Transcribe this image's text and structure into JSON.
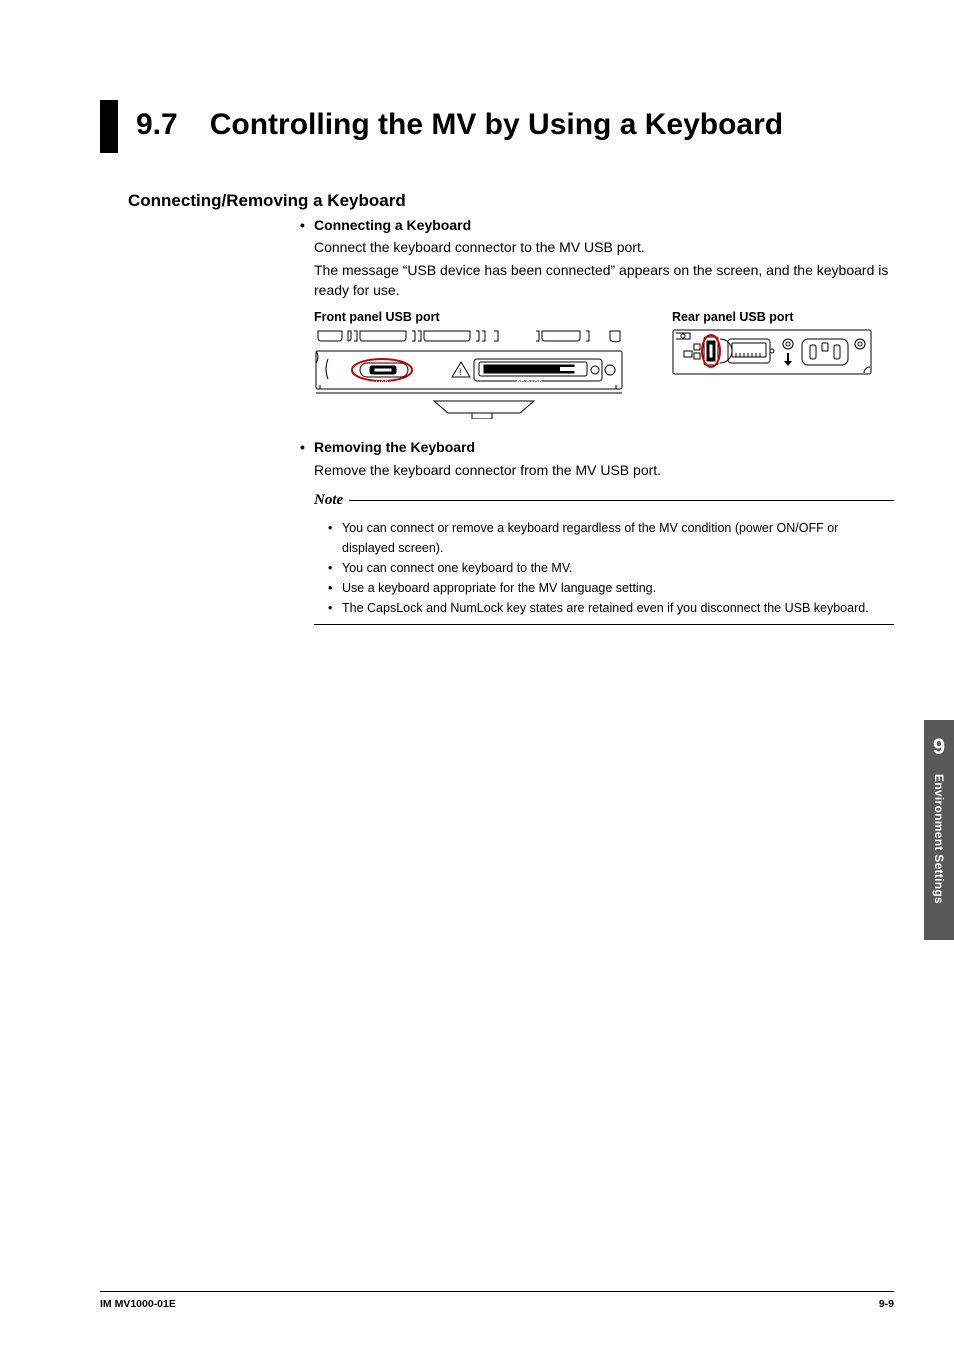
{
  "heading": {
    "number": "9.7",
    "title": "Controlling the MV by Using a Keyboard"
  },
  "section1": {
    "title": "Connecting/Removing a Keyboard",
    "connect": {
      "head": "Connecting a Keyboard",
      "p1": "Connect the keyboard connector to the MV USB port.",
      "p2": "The message “USB device has been connected” appears on the screen, and the keyboard is ready for use.",
      "figFrontLabel": "Front panel USB port",
      "figRearLabel": "Rear panel USB port",
      "figFrontTextUSB": "USB",
      "figFrontTextCF": "CF CARD"
    },
    "remove": {
      "head": "Removing the Keyboard",
      "p1": "Remove the keyboard connector from the MV USB port."
    },
    "note": {
      "word": "Note",
      "items": [
        "You can connect or remove a keyboard regardless of the MV condition (power ON/OFF or displayed screen).",
        "You can connect one keyboard to the MV.",
        "Use a keyboard appropriate for the MV language setting.",
        "The CapsLock and NumLock key states are retained even if you disconnect the USB keyboard."
      ]
    }
  },
  "sideTab": {
    "chapter": "9",
    "label": "Environment Settings"
  },
  "footer": {
    "left": "IM MV1000-01E",
    "right": "9-9"
  }
}
